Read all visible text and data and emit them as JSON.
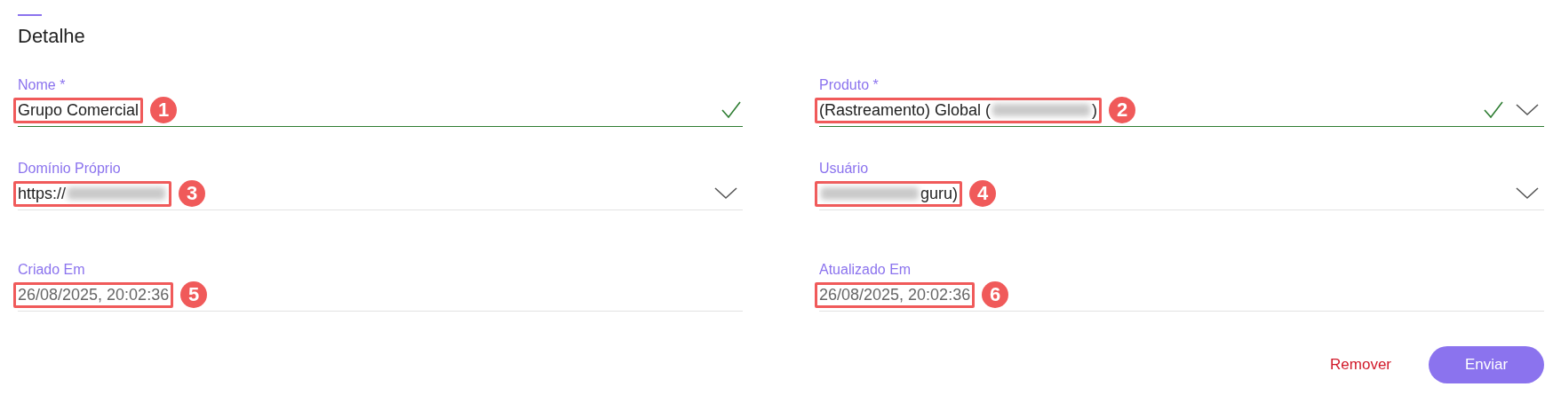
{
  "section": {
    "title": "Detalhe"
  },
  "fields": [
    {
      "label": "Nome *",
      "segments": [
        {
          "kind": "text",
          "text": "Grupo Comercial"
        }
      ],
      "marker": "1",
      "valid": true,
      "dropdown": false,
      "readonly": false
    },
    {
      "label": "Produto *",
      "segments": [
        {
          "kind": "text",
          "text": "(Rastreamento) Global ("
        },
        {
          "kind": "blur"
        },
        {
          "kind": "text",
          "text": ")"
        }
      ],
      "marker": "2",
      "valid": true,
      "dropdown": true,
      "readonly": false
    },
    {
      "label": "Domínio Próprio",
      "segments": [
        {
          "kind": "text",
          "text": "https://"
        },
        {
          "kind": "blur"
        }
      ],
      "marker": "3",
      "valid": false,
      "dropdown": true,
      "readonly": false
    },
    {
      "label": "Usuário",
      "segments": [
        {
          "kind": "blur"
        },
        {
          "kind": "text",
          "text": "guru)"
        }
      ],
      "marker": "4",
      "valid": false,
      "dropdown": true,
      "readonly": false
    },
    {
      "label": "Criado Em",
      "segments": [
        {
          "kind": "text",
          "text": "26/08/2025, 20:02:36"
        }
      ],
      "marker": "5",
      "valid": false,
      "dropdown": false,
      "readonly": true
    },
    {
      "label": "Atualizado Em",
      "segments": [
        {
          "kind": "text",
          "text": "26/08/2025, 20:02:36"
        }
      ],
      "marker": "6",
      "valid": false,
      "dropdown": false,
      "readonly": true
    }
  ],
  "actions": [
    {
      "label": "Remover",
      "kind": "text"
    },
    {
      "label": "Enviar",
      "kind": "primary"
    }
  ]
}
